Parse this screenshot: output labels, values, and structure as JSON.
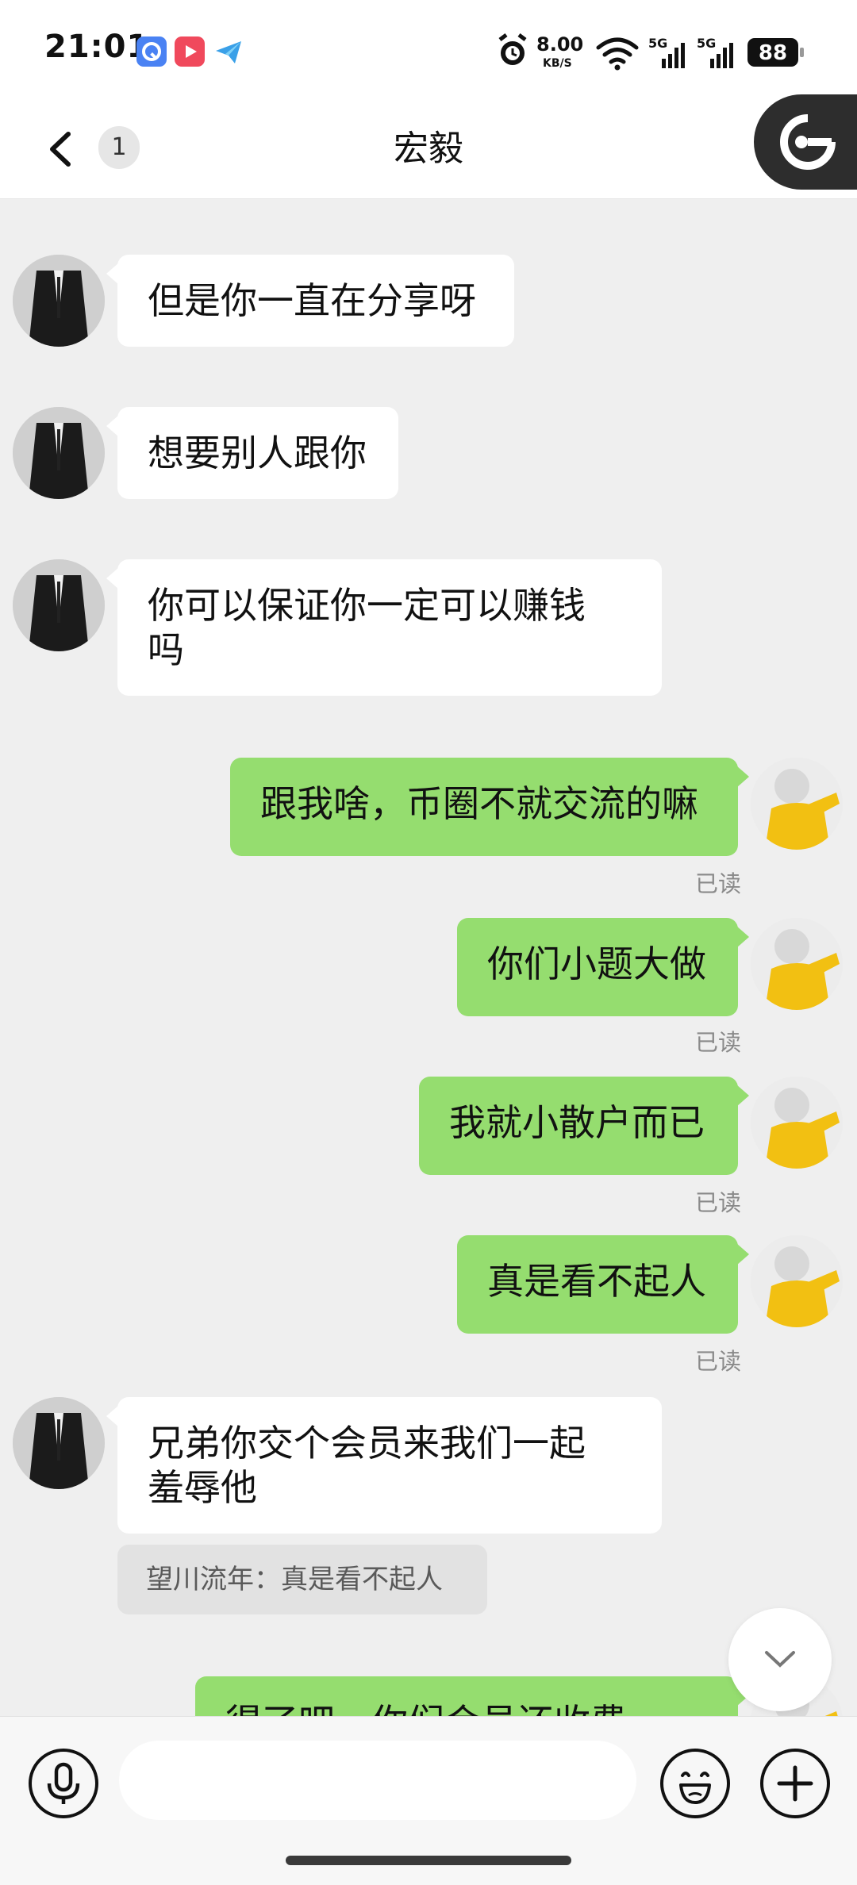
{
  "status_bar": {
    "time": "21:01",
    "speed_value": "8.00",
    "speed_unit": "KB/S",
    "network_1": "5G",
    "network_2": "5G",
    "battery": "88"
  },
  "header": {
    "unread_count": "1",
    "title": "宏毅"
  },
  "messages": [
    {
      "side": "them",
      "text": "但是你一直在分享呀"
    },
    {
      "side": "them",
      "text": "想要别人跟你"
    },
    {
      "side": "them",
      "text": "你可以保证你一定可以赚钱\n吗"
    },
    {
      "side": "me",
      "text": "跟我啥，币圈不就交流的嘛",
      "status": "已读"
    },
    {
      "side": "me",
      "text": "你们小题大做",
      "status": "已读"
    },
    {
      "side": "me",
      "text": "我就小散户而已",
      "status": "已读"
    },
    {
      "side": "me",
      "text": "真是看不起人",
      "status": "已读"
    },
    {
      "side": "them",
      "text": "兄弟你交个会员来我们一起\n羞辱他",
      "quote": "望川流年：真是看不起人"
    },
    {
      "side": "me",
      "text": "得了吧，你们会员还收费"
    }
  ],
  "input": {
    "placeholder": ""
  },
  "colors": {
    "my_bubble": "#95dd6f",
    "their_bubble": "#ffffff",
    "background": "#efefef"
  }
}
